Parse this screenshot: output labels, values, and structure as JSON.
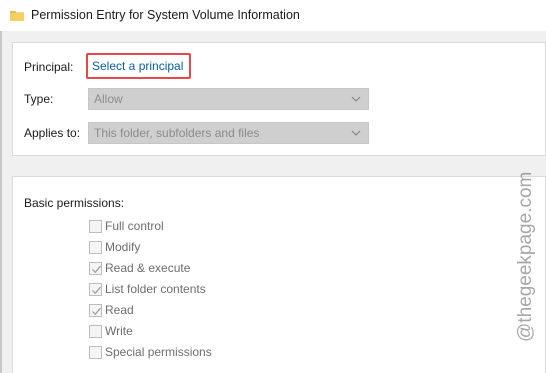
{
  "window": {
    "title": "Permission Entry for System Volume Information"
  },
  "principal": {
    "label": "Principal:",
    "link_text": "Select a principal"
  },
  "type": {
    "label": "Type:",
    "value": "Allow"
  },
  "applies_to": {
    "label": "Applies to:",
    "value": "This folder, subfolders and files"
  },
  "basic_permissions": {
    "heading": "Basic permissions:",
    "items": [
      {
        "label": "Full control",
        "checked": false
      },
      {
        "label": "Modify",
        "checked": false
      },
      {
        "label": "Read & execute",
        "checked": true
      },
      {
        "label": "List folder contents",
        "checked": true
      },
      {
        "label": "Read",
        "checked": true
      },
      {
        "label": "Write",
        "checked": false
      },
      {
        "label": "Special permissions",
        "checked": false
      }
    ]
  },
  "watermark": "@thegeekpage.com",
  "colors": {
    "link": "#0a5fa8",
    "highlight_border": "#e8474a",
    "disabled_combo": "#cfcfcf"
  },
  "icons": {
    "window": "folder-icon",
    "combo": "chevron-down-icon",
    "check": "checkmark-icon"
  }
}
